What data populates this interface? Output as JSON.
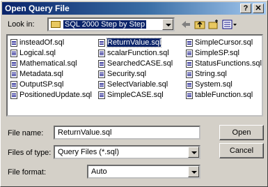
{
  "title": "Open Query File",
  "title_buttons": {
    "help": "?",
    "close": "✕"
  },
  "look_in": {
    "label": "Look in:",
    "value": "SQL 2000 Step by Step"
  },
  "toolbar": {
    "back_icon": "back-arrow-icon",
    "up_icon": "up-folder-icon",
    "new_folder_icon": "new-folder-icon",
    "views_icon": "views-menu-icon"
  },
  "files": [
    "insteadOf.sql",
    "Logical.sql",
    "Mathematical.sql",
    "Metadata.sql",
    "OutputSP.sql",
    "PositionedUpdate.sql",
    "ReturnValue.sql",
    "scalarFunction.sql",
    "SearchedCASE.sql",
    "Security.sql",
    "SelectVariable.sql",
    "SimpleCASE.sql",
    "SimpleCursor.sql",
    "SimpleSP.sql",
    "StatusFunctions.sql",
    "String.sql",
    "System.sql",
    "tableFunction.sql"
  ],
  "selected_file": "ReturnValue.sql",
  "file_name": {
    "label": "File name:",
    "value": "ReturnValue.sql"
  },
  "files_of_type": {
    "label": "Files of type:",
    "value": "Query Files (*.sql)"
  },
  "file_format": {
    "label": "File format:",
    "value": "Auto"
  },
  "buttons": {
    "open": "Open",
    "cancel": "Cancel"
  }
}
